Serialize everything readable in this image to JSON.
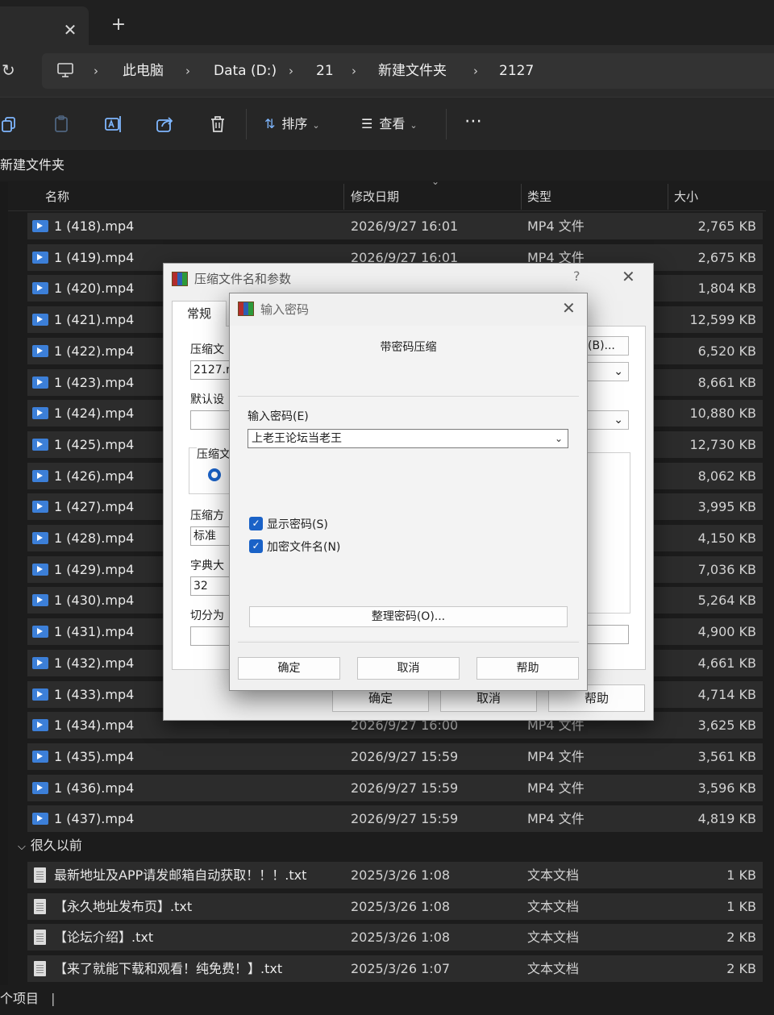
{
  "tabbar": {
    "close_glyph": "✕",
    "new_tab_glyph": "+"
  },
  "address": {
    "refresh_glyph": "↻",
    "separator": "›",
    "crumbs": [
      "此电脑",
      "Data (D:)",
      "21",
      "新建文件夹",
      "2127"
    ]
  },
  "toolbar": {
    "sort_label": "排序",
    "view_label": "查看",
    "more_glyph": "⋯"
  },
  "folder_title": "新建文件夹",
  "columns": {
    "name": "名称",
    "date": "修改日期",
    "type": "类型",
    "size": "大小"
  },
  "files": [
    {
      "name": "1 (418).mp4",
      "date": "2026/9/27 16:01",
      "type": "MP4 文件",
      "size": "2,765 KB",
      "icon": "video-file-icon"
    },
    {
      "name": "1 (419).mp4",
      "date": "2026/9/27 16:01",
      "type": "MP4 文件",
      "size": "2,675 KB",
      "icon": "video-file-icon"
    },
    {
      "name": "1 (420).mp4",
      "date": "",
      "type": "",
      "size": "1,804 KB",
      "icon": "video-file-icon"
    },
    {
      "name": "1 (421).mp4",
      "date": "",
      "type": "",
      "size": "12,599 KB",
      "icon": "video-file-icon"
    },
    {
      "name": "1 (422).mp4",
      "date": "",
      "type": "",
      "size": "6,520 KB",
      "icon": "video-file-icon"
    },
    {
      "name": "1 (423).mp4",
      "date": "",
      "type": "",
      "size": "8,661 KB",
      "icon": "video-file-icon"
    },
    {
      "name": "1 (424).mp4",
      "date": "",
      "type": "",
      "size": "10,880 KB",
      "icon": "video-file-icon"
    },
    {
      "name": "1 (425).mp4",
      "date": "",
      "type": "",
      "size": "12,730 KB",
      "icon": "video-file-icon"
    },
    {
      "name": "1 (426).mp4",
      "date": "",
      "type": "",
      "size": "8,062 KB",
      "icon": "video-file-icon"
    },
    {
      "name": "1 (427).mp4",
      "date": "",
      "type": "",
      "size": "3,995 KB",
      "icon": "video-file-icon"
    },
    {
      "name": "1 (428).mp4",
      "date": "",
      "type": "",
      "size": "4,150 KB",
      "icon": "video-file-icon"
    },
    {
      "name": "1 (429).mp4",
      "date": "",
      "type": "",
      "size": "7,036 KB",
      "icon": "video-file-icon"
    },
    {
      "name": "1 (430).mp4",
      "date": "",
      "type": "",
      "size": "5,264 KB",
      "icon": "video-file-icon"
    },
    {
      "name": "1 (431).mp4",
      "date": "",
      "type": "",
      "size": "4,900 KB",
      "icon": "video-file-icon"
    },
    {
      "name": "1 (432).mp4",
      "date": "",
      "type": "",
      "size": "4,661 KB",
      "icon": "video-file-icon"
    },
    {
      "name": "1 (433).mp4",
      "date": "",
      "type": "",
      "size": "4,714 KB",
      "icon": "video-file-icon"
    },
    {
      "name": "1 (434).mp4",
      "date": "2026/9/27 16:00",
      "type": "MP4 文件",
      "size": "3,625 KB",
      "icon": "video-file-icon"
    },
    {
      "name": "1 (435).mp4",
      "date": "2026/9/27 15:59",
      "type": "MP4 文件",
      "size": "3,561 KB",
      "icon": "video-file-icon"
    },
    {
      "name": "1 (436).mp4",
      "date": "2026/9/27 15:59",
      "type": "MP4 文件",
      "size": "3,596 KB",
      "icon": "video-file-icon"
    },
    {
      "name": "1 (437).mp4",
      "date": "2026/9/27 15:59",
      "type": "MP4 文件",
      "size": "4,819 KB",
      "icon": "video-file-icon"
    }
  ],
  "group_label": "很久以前",
  "old_files": [
    {
      "name": "最新地址及APP请发邮箱自动获取！！！.txt",
      "date": "2025/3/26 1:08",
      "type": "文本文档",
      "size": "1 KB",
      "icon": "text-file-icon"
    },
    {
      "name": "【永久地址发布页】.txt",
      "date": "2025/3/26 1:08",
      "type": "文本文档",
      "size": "1 KB",
      "icon": "text-file-icon"
    },
    {
      "name": "【论坛介绍】.txt",
      "date": "2025/3/26 1:08",
      "type": "文本文档",
      "size": "2 KB",
      "icon": "text-file-icon"
    },
    {
      "name": "【来了就能下载和观看！纯免费！】.txt",
      "date": "2025/3/26 1:07",
      "type": "文本文档",
      "size": "2 KB",
      "icon": "text-file-icon"
    }
  ],
  "status": {
    "items_label": "个项目"
  },
  "params_dialog": {
    "title": "压缩文件名和参数",
    "help_glyph": "?",
    "close_glyph": "✕",
    "tab_general": "常规",
    "archive_name_label": "压缩文",
    "archive_name_value": "2127.r",
    "browse_label": "(B)...",
    "default_profile_label": "默认设",
    "format_label": "压缩文",
    "method_label": "压缩方",
    "method_value": "标准",
    "dict_label": "字典大",
    "dict_value": "32",
    "split_label": "切分为",
    "ok": "确定",
    "cancel": "取消",
    "help": "帮助"
  },
  "password_dialog": {
    "title": "输入密码",
    "close_glyph": "✕",
    "heading": "带密码压缩",
    "password_label": "输入密码(E)",
    "password_value": "上老王论坛当老王",
    "show_password_label": "显示密码(S)",
    "show_password_checked": true,
    "encrypt_names_label": "加密文件名(N)",
    "encrypt_names_checked": true,
    "organize_label": "整理密码(O)...",
    "ok": "确定",
    "cancel": "取消",
    "help": "帮助"
  },
  "colors": {
    "accent": "#1a62c7",
    "row_bg": "#2c2c2c",
    "toolbar_icon": "#7fb7ff"
  }
}
